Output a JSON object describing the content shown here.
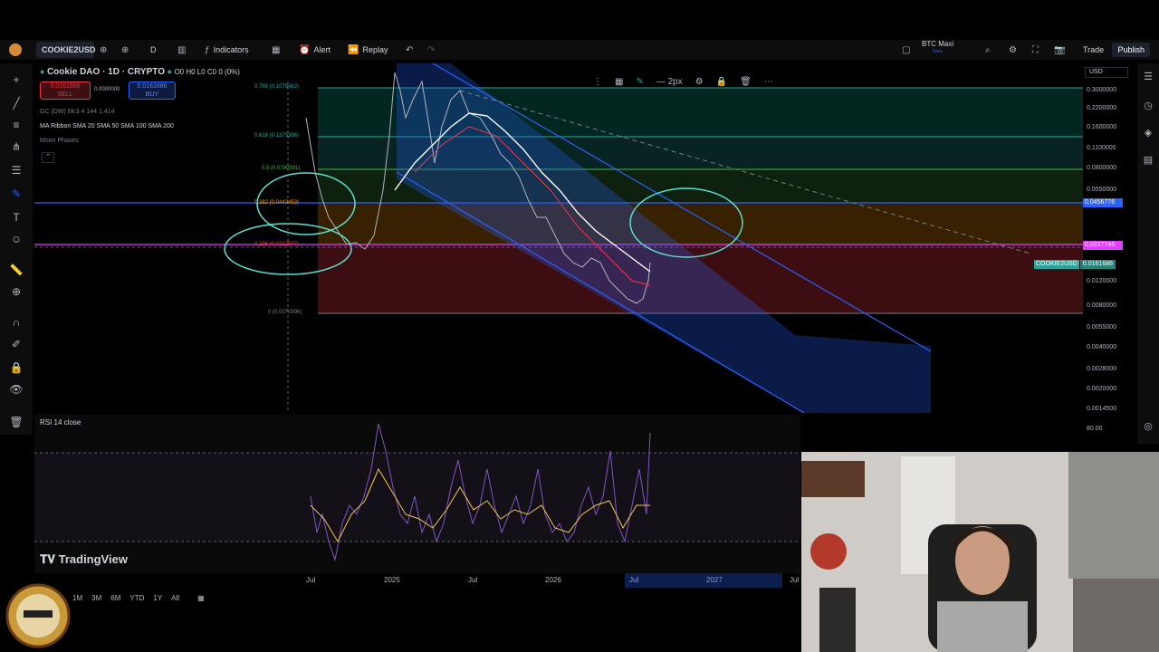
{
  "topbar": {
    "symbol": "COOKIE2USD",
    "interval": "D",
    "indicators_label": "Indicators",
    "alert_label": "Alert",
    "replay_label": "Replay",
    "layout_name": "BTC Maxi",
    "layout_sub": "Save",
    "trade_label": "Trade",
    "publish_label": "Publish"
  },
  "legend": {
    "title": "Cookie DAO · 1D · CRYPTO",
    "ohlc": "O0 H0 L0 C0 0 (0%)",
    "sell_price": "0.0161686",
    "sell_label": "SELL",
    "spread": "0.0000000",
    "buy_price": "0.0161686",
    "buy_label": "BUY",
    "line3": "GC (DW) hlc3 4 144 1.414",
    "ma_ribbon": "MA Ribbon SMA 20 SMA 50 SMA 100 SMA 200",
    "moon_phases": "Moon Phases"
  },
  "fib_labels": [
    {
      "text": "0.786 (0.1078482)",
      "level": 0.786
    },
    {
      "text": "0.618 (0.1375386)",
      "level": 0.618
    },
    {
      "text": "0.5 (0.0780591)",
      "level": 0.5
    },
    {
      "text": "0.382 (0.0443453)",
      "level": 0.382
    },
    {
      "text": "0.236 (0.0212547)",
      "level": 0.236
    },
    {
      "text": "0 (0.0070996)",
      "level": 0
    }
  ],
  "price_axis": {
    "currency": "USD",
    "labels": [
      "0.3000000",
      "0.2200000",
      "0.1600000",
      "0.1100000",
      "0.0800000",
      "0.0550000",
      "0.0400000",
      "0.0120000",
      "0.0080000",
      "0.0055000",
      "0.0040000",
      "0.0028000",
      "0.0020000",
      "0.0014500"
    ],
    "tag_blue": "0.0456776",
    "tag_blue_sub": "0.0400000",
    "tag_pink": "0.0227745",
    "tag_current_symbol": "COOKIE2USD",
    "tag_current": "0.0161686"
  },
  "rsi": {
    "label": "RSI 14 close",
    "axis_top": "80.00"
  },
  "time_axis": [
    "Jul",
    "2025",
    "Jul",
    "2026",
    "Jul",
    "2027",
    "Jul"
  ],
  "ranges": [
    "1M",
    "3M",
    "6M",
    "YTD",
    "1Y",
    "All"
  ],
  "watermark": "TradingView",
  "drawing_toolbar": {
    "width_label": "2px"
  },
  "colors": {
    "accent": "#2962ff",
    "fib_green": "#089981",
    "fib_red": "#f23645",
    "channel_blue": "#2962ff",
    "rsi_purple": "#7e57c2",
    "rsi_yellow": "#f7c948",
    "price_pink": "#e040fb",
    "current_green": "#26a69a"
  },
  "icons": {
    "logo": "tradingview-logo",
    "webcam": "presenter-video-feed"
  }
}
